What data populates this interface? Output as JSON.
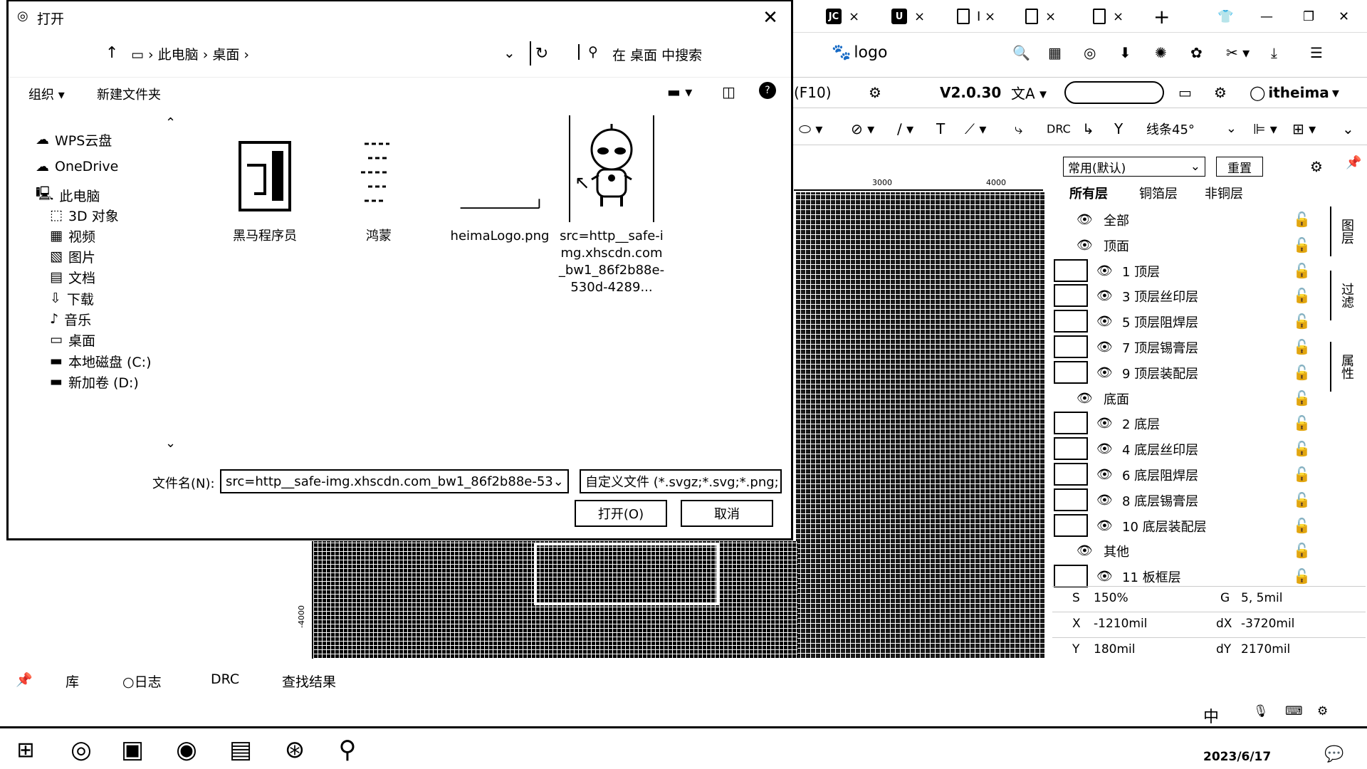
{
  "dialog": {
    "title": "打开",
    "address": {
      "up_arrow": "↑",
      "crumbs": [
        "此电脑",
        "桌面"
      ]
    },
    "search_placeholder": "在 桌面 中搜索",
    "toolbar": {
      "organize": "组织 ▾",
      "new_folder": "新建文件夹"
    },
    "nav": [
      {
        "label": "WPS云盘",
        "icon": "cloud-icon"
      },
      {
        "label": "OneDrive",
        "icon": "onedrive-icon"
      },
      {
        "label": "此电脑",
        "icon": "computer-icon"
      },
      {
        "label": "3D 对象",
        "icon": "cube-icon"
      },
      {
        "label": "视频",
        "icon": "video-icon"
      },
      {
        "label": "图片",
        "icon": "picture-icon"
      },
      {
        "label": "文档",
        "icon": "document-icon"
      },
      {
        "label": "下载",
        "icon": "download-icon"
      },
      {
        "label": "音乐",
        "icon": "music-icon"
      },
      {
        "label": "桌面",
        "icon": "desktop-icon"
      },
      {
        "label": "本地磁盘 (C:)",
        "icon": "disk-icon"
      },
      {
        "label": "新加卷 (D:)",
        "icon": "disk-icon"
      }
    ],
    "files": [
      {
        "name": "黑马程序员"
      },
      {
        "name": "鸿蒙"
      },
      {
        "name": "heimaLogo.png"
      },
      {
        "name": "src=http__safe-img.xhscdn.com_bw1_86f2b88e-530d-4289..."
      }
    ],
    "filename_label": "文件名(N):",
    "filename_value": "src=http__safe-img.xhscdn.com_bw1_86f2b88e-53",
    "filetype_value": "自定义文件 (*.svgz;*.svg;*.png;",
    "open_label": "打开(O)",
    "cancel_label": "取消"
  },
  "browser": {
    "tabs": [
      {
        "icon": "JC",
        "label": "×"
      },
      {
        "icon": "U",
        "label": "×"
      },
      {
        "icon": "",
        "label": "I ×"
      },
      {
        "icon": "",
        "label": "×"
      },
      {
        "icon": "",
        "label": "×"
      }
    ],
    "new_tab": "+",
    "page_title": "logo"
  },
  "editor": {
    "menu_hint": "(F10)",
    "version": "V2.0.30",
    "user": "itheima",
    "route_mode": "线条45°",
    "drc_label": "DRC",
    "ruler_ticks": [
      "3000",
      "4000"
    ],
    "left_ruler": "-4000"
  },
  "layers": {
    "preset": "常用(默认)",
    "reset": "重置",
    "tabs": [
      "所有层",
      "铜箔层",
      "非铜层"
    ],
    "rows": [
      {
        "name": "全部",
        "group": true,
        "indent": 0
      },
      {
        "name": "顶面",
        "group": true,
        "indent": 0
      },
      {
        "name": "1 顶层",
        "group": false,
        "indent": 1
      },
      {
        "name": "3 顶层丝印层",
        "group": false,
        "indent": 1
      },
      {
        "name": "5 顶层阻焊层",
        "group": false,
        "indent": 1
      },
      {
        "name": "7 顶层锡膏层",
        "group": false,
        "indent": 1
      },
      {
        "name": "9 顶层装配层",
        "group": false,
        "indent": 1
      },
      {
        "name": "底面",
        "group": true,
        "indent": 0
      },
      {
        "name": "2 底层",
        "group": false,
        "indent": 1
      },
      {
        "name": "4 底层丝印层",
        "group": false,
        "indent": 1
      },
      {
        "name": "6 底层阻焊层",
        "group": false,
        "indent": 1
      },
      {
        "name": "8 底层锡膏层",
        "group": false,
        "indent": 1
      },
      {
        "name": "10 底层装配层",
        "group": false,
        "indent": 1
      },
      {
        "name": "其他",
        "group": true,
        "indent": 0
      },
      {
        "name": "11 板框层",
        "group": false,
        "indent": 1
      }
    ],
    "side_tabs": [
      "图层",
      "过滤",
      "属性"
    ]
  },
  "status": {
    "S": "150%",
    "G": "5, 5mil",
    "X": "-1210mil",
    "dX": "-3720mil",
    "Y": "180mil",
    "dY": "2170mil"
  },
  "bottom_tabs": [
    "库",
    "日志",
    "DRC",
    "查找结果"
  ],
  "tray": {
    "ime": "中",
    "date": "2023/6/17"
  }
}
